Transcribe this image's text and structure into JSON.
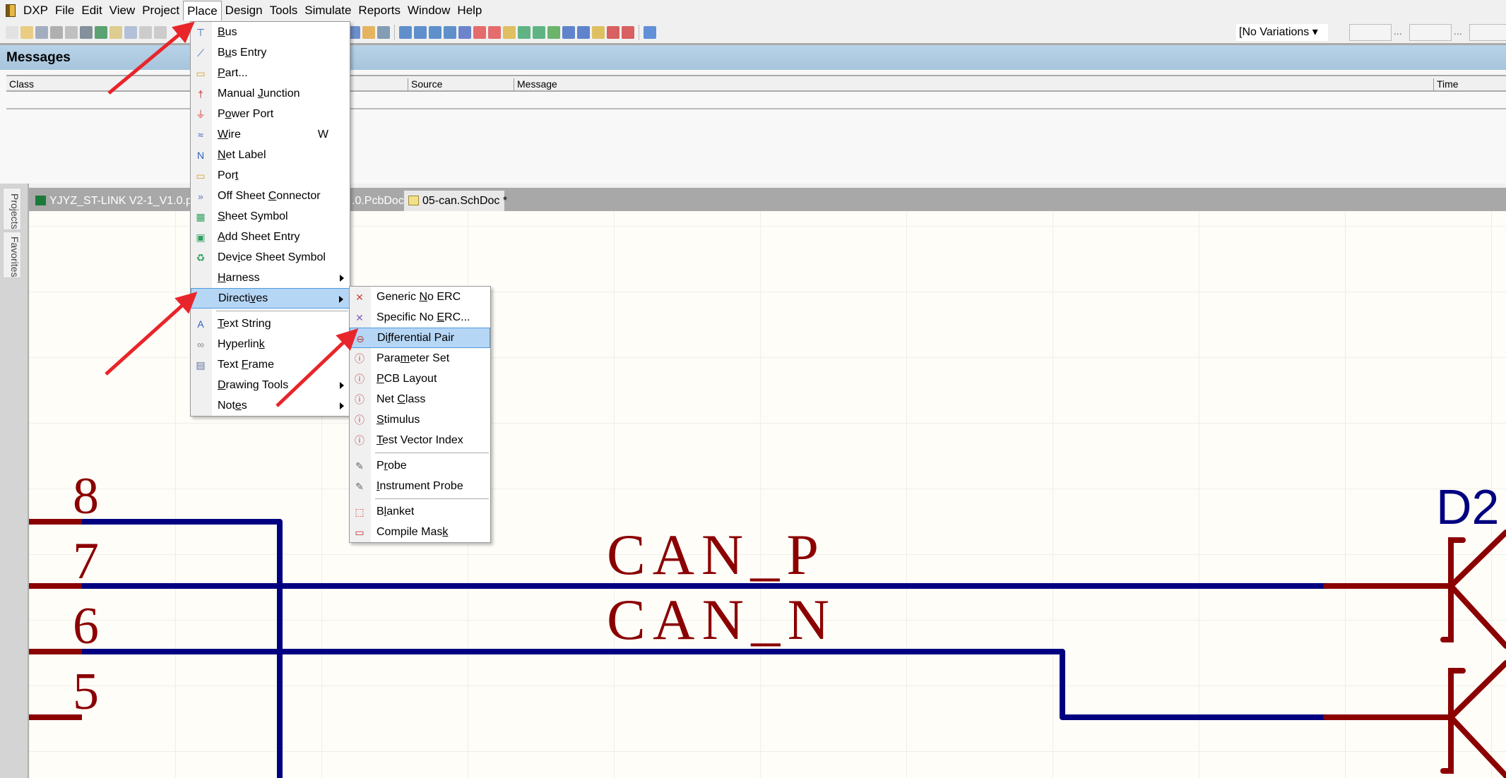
{
  "menubar": {
    "items": [
      "DXP",
      "File",
      "Edit",
      "View",
      "Project",
      "Place",
      "Design",
      "Tools",
      "Simulate",
      "Reports",
      "Window",
      "Help"
    ],
    "open": "Place"
  },
  "toolbar": {
    "variations": "[No Variations"
  },
  "messages": {
    "title": "Messages",
    "columns": [
      "Class",
      "Source",
      "Message",
      "Time"
    ]
  },
  "sidebar": {
    "tabs": [
      "Projects",
      "Favorites"
    ]
  },
  "tabs": [
    {
      "label": "YJYZ_ST-LINK V2-1_V1.0.pcb"
    },
    {
      "label": ".0.PcbDoc"
    },
    {
      "label": "05-can.SchDoc *",
      "active": true
    }
  ],
  "place_menu": [
    {
      "label": "Bus",
      "accel": "B",
      "icon": "bus-icon"
    },
    {
      "label": "Bus Entry",
      "accel": "u",
      "icon": "bus-entry-icon"
    },
    {
      "label": "Part...",
      "accel": "P",
      "icon": "part-icon"
    },
    {
      "label": "Manual Junction",
      "accel": "J",
      "icon": "junction-icon"
    },
    {
      "label": "Power Port",
      "accel": "o",
      "icon": "power-port-icon"
    },
    {
      "label": "Wire",
      "accel": "W",
      "shortcut": "W",
      "icon": "wire-icon"
    },
    {
      "label": "Net Label",
      "accel": "N",
      "icon": "net-label-icon"
    },
    {
      "label": "Port",
      "accel": "t",
      "icon": "port-icon"
    },
    {
      "label": "Off Sheet Connector",
      "accel": "C",
      "icon": "off-sheet-connector-icon"
    },
    {
      "label": "Sheet Symbol",
      "accel": "S",
      "icon": "sheet-symbol-icon"
    },
    {
      "label": "Add Sheet Entry",
      "accel": "A",
      "icon": "sheet-entry-icon"
    },
    {
      "label": "Device Sheet Symbol",
      "accel": "i",
      "icon": "device-sheet-icon"
    },
    {
      "label": "Harness",
      "accel": "H",
      "submenu": true
    },
    {
      "label": "Directives",
      "accel": "v",
      "submenu": true,
      "highlighted": true,
      "separator_after": true
    },
    {
      "label": "Text String",
      "accel": "T",
      "icon": "text-string-icon"
    },
    {
      "label": "Hyperlink",
      "accel": "k",
      "icon": "hyperlink-icon"
    },
    {
      "label": "Text Frame",
      "accel": "F",
      "icon": "text-frame-icon"
    },
    {
      "label": "Drawing Tools",
      "accel": "D",
      "submenu": true
    },
    {
      "label": "Notes",
      "accel": "e",
      "submenu": true
    }
  ],
  "directives_menu": [
    {
      "label": "Generic No ERC",
      "accel": "N",
      "icon": "no-erc-icon"
    },
    {
      "label": "Specific No ERC...",
      "accel": "E",
      "icon": "specific-no-erc-icon"
    },
    {
      "label": "Differential Pair",
      "accel": "f",
      "icon": "differential-pair-icon",
      "highlighted": true
    },
    {
      "label": "Parameter Set",
      "accel": "m",
      "icon": "parameter-set-icon"
    },
    {
      "label": "PCB Layout",
      "accel": "P",
      "icon": "pcb-layout-icon"
    },
    {
      "label": "Net Class",
      "accel": "C",
      "icon": "net-class-icon"
    },
    {
      "label": "Stimulus",
      "accel": "S",
      "icon": "stimulus-icon"
    },
    {
      "label": "Test Vector Index",
      "accel": "T",
      "icon": "test-vector-icon",
      "separator_after": true
    },
    {
      "label": "Probe",
      "accel": "r",
      "icon": "probe-icon"
    },
    {
      "label": "Instrument Probe",
      "accel": "I",
      "icon": "instrument-probe-icon",
      "separator_after": true
    },
    {
      "label": "Blanket",
      "accel": "l",
      "icon": "blanket-icon"
    },
    {
      "label": "Compile Mask",
      "accel": "k",
      "icon": "compile-mask-icon"
    }
  ],
  "schematic": {
    "pins": [
      "8",
      "7",
      "6",
      "5"
    ],
    "nets": [
      "CAN_P",
      "CAN_N"
    ],
    "designator": "D2"
  },
  "colors": {
    "wire": "#000080",
    "pin": "#8b0000",
    "accent": "#e8252a",
    "highlight": "#b6d6f5"
  }
}
